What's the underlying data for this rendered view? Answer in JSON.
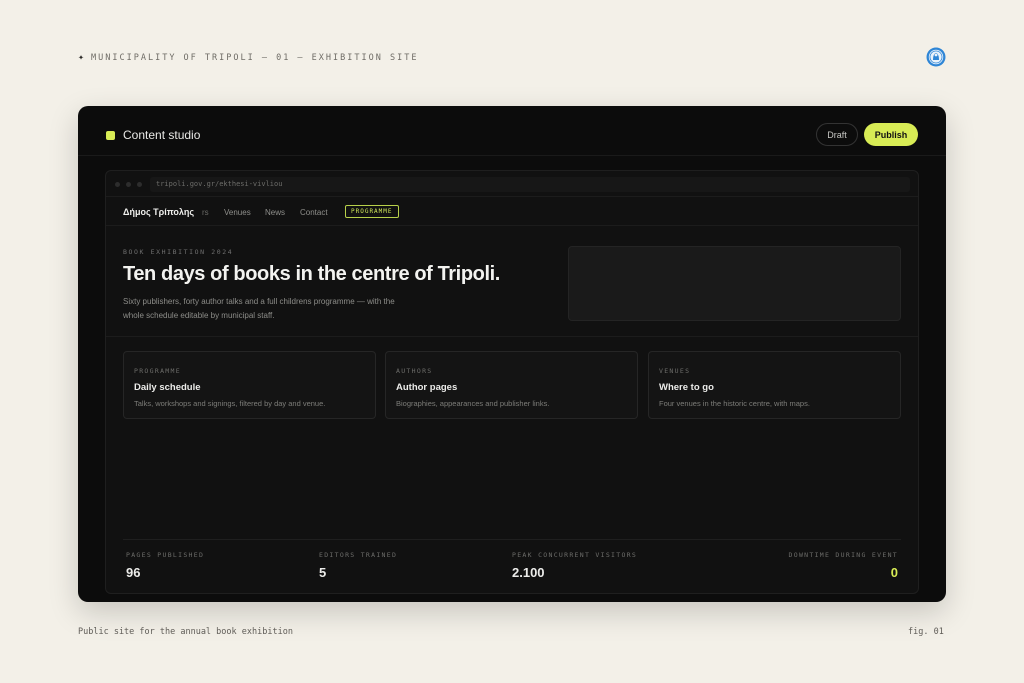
{
  "page": {
    "eyebrow": "MUNICIPALITY OF TRIPOLI — 01 — EXHIBITION SITE",
    "caption": "Public site for the annual book exhibition",
    "fig": "fig. 01"
  },
  "studio": {
    "title": "Content studio",
    "draft_label": "Draft",
    "publish_label": "Publish",
    "accent": "#d8ec55"
  },
  "browser": {
    "url": "tripoli.gov.gr/ekthesi-vivliou"
  },
  "site": {
    "brand": "Δήμος Τρίπολης",
    "nav": {
      "authors_fragment": "rs",
      "venues": "Venues",
      "news": "News",
      "contact": "Contact",
      "programme": "PROGRAMME"
    },
    "hero": {
      "kicker": "BOOK EXHIBITION 2024",
      "title": "Ten days of books in the centre of Tripoli.",
      "subtitle": "Sixty publishers, forty author talks and a full childrens programme — with the whole schedule editable by municipal staff."
    },
    "features": [
      {
        "kicker": "PROGRAMME",
        "title": "Daily schedule",
        "desc": "Talks, workshops and signings, filtered by day and venue."
      },
      {
        "kicker": "AUTHORS",
        "title": "Author pages",
        "desc": "Biographies, appearances and publisher links."
      },
      {
        "kicker": "VENUES",
        "title": "Where to go",
        "desc": "Four venues in the historic centre, with maps."
      }
    ]
  },
  "stats": [
    {
      "label": "PAGES PUBLISHED",
      "value": "96"
    },
    {
      "label": "EDITORS TRAINED",
      "value": "5"
    },
    {
      "label": "PEAK CONCURRENT VISITORS",
      "value": "2.100"
    },
    {
      "label": "DOWNTIME DURING EVENT",
      "value": "0"
    }
  ]
}
